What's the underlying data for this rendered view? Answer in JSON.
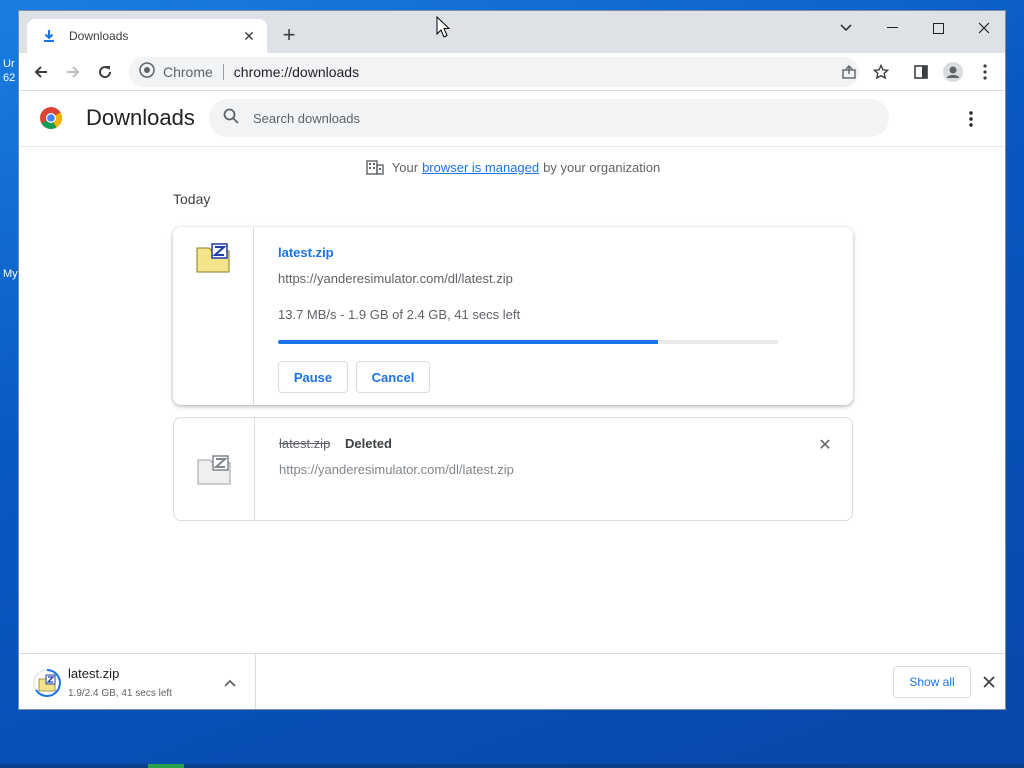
{
  "desktop": {
    "text_top": "Ur",
    "text_mid": "62",
    "text_low": "My"
  },
  "browser": {
    "tab_title": "Downloads",
    "omnibox_site": "Chrome",
    "omnibox_url": "chrome://downloads"
  },
  "page": {
    "title": "Downloads",
    "search_placeholder": "Search downloads",
    "managed_prefix": "Your",
    "managed_link": "browser is managed",
    "managed_suffix": "by your organization",
    "section": "Today"
  },
  "downloads": [
    {
      "name": "latest.zip",
      "url": "https://yanderesimulator.com/dl/latest.zip",
      "status": "13.7 MB/s - 1.9 GB of 2.4 GB, 41 secs left",
      "progress": 0.76,
      "pause_label": "Pause",
      "cancel_label": "Cancel"
    },
    {
      "name": "latest.zip",
      "state": "Deleted",
      "url": "https://yanderesimulator.com/dl/latest.zip"
    }
  ],
  "shelf": {
    "name": "latest.zip",
    "status": "1.9/2.4 GB, 41 secs left",
    "show_all": "Show all"
  },
  "colors": {
    "accent": "#1a73e8",
    "tabbar": "#dee1e6"
  }
}
